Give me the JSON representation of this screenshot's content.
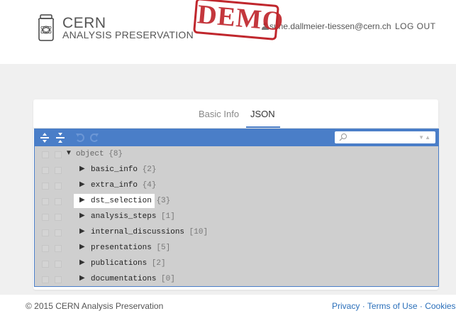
{
  "header": {
    "brand_line1": "CERN",
    "brand_line2": "ANALYSIS PRESERVATION",
    "stamp": "DEMO",
    "user_email": "sune.dallmeier-tiessen@cern.ch",
    "logout_label": "LOG OUT"
  },
  "tabs": [
    {
      "label": "Basic Info",
      "active": false
    },
    {
      "label": "JSON",
      "active": true
    }
  ],
  "editor": {
    "search_placeholder": "",
    "root": {
      "key": "object",
      "count": "{8}"
    },
    "rows": [
      {
        "key": "basic_info",
        "count": "{2}"
      },
      {
        "key": "extra_info",
        "count": "{4}"
      },
      {
        "key": "dst_selection",
        "count": "{3}"
      },
      {
        "key": "analysis_steps",
        "count": "[1]"
      },
      {
        "key": "internal_discussions",
        "count": "[10]"
      },
      {
        "key": "presentations",
        "count": "[5]"
      },
      {
        "key": "publications",
        "count": "[2]"
      },
      {
        "key": "documentations",
        "count": "[0]"
      }
    ]
  },
  "footer": {
    "copyright": "© 2015 CERN Analysis Preservation",
    "privacy": "Privacy",
    "terms": "Terms of Use",
    "cookies": "Cookies",
    "separator": "·"
  },
  "colors": {
    "accent": "#4a7ec8",
    "stamp": "#c0272d",
    "link": "#2a6fba"
  }
}
